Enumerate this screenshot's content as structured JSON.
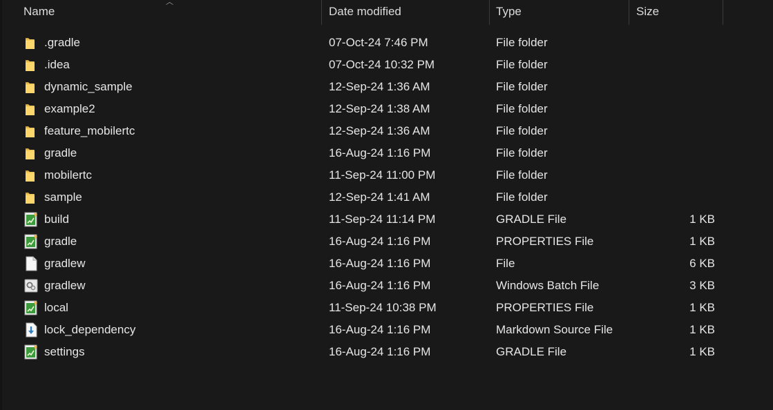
{
  "columns": {
    "name": "Name",
    "date_modified": "Date modified",
    "type": "Type",
    "size": "Size"
  },
  "files": [
    {
      "icon": "folder-icon",
      "name": ".gradle",
      "date": "07-Oct-24 7:46 PM",
      "type": "File folder",
      "size": ""
    },
    {
      "icon": "folder-icon",
      "name": ".idea",
      "date": "07-Oct-24 10:32 PM",
      "type": "File folder",
      "size": ""
    },
    {
      "icon": "folder-icon",
      "name": "dynamic_sample",
      "date": "12-Sep-24 1:36 AM",
      "type": "File folder",
      "size": ""
    },
    {
      "icon": "folder-icon",
      "name": "example2",
      "date": "12-Sep-24 1:38 AM",
      "type": "File folder",
      "size": ""
    },
    {
      "icon": "folder-icon",
      "name": "feature_mobilertc",
      "date": "12-Sep-24 1:36 AM",
      "type": "File folder",
      "size": ""
    },
    {
      "icon": "folder-icon",
      "name": "gradle",
      "date": "16-Aug-24 1:16 PM",
      "type": "File folder",
      "size": ""
    },
    {
      "icon": "folder-icon",
      "name": "mobilertc",
      "date": "11-Sep-24 11:00 PM",
      "type": "File folder",
      "size": ""
    },
    {
      "icon": "folder-icon",
      "name": "sample",
      "date": "12-Sep-24 1:41 AM",
      "type": "File folder",
      "size": ""
    },
    {
      "icon": "gradle-file-icon",
      "name": "build",
      "date": "11-Sep-24 11:14 PM",
      "type": "GRADLE File",
      "size": "1 KB"
    },
    {
      "icon": "gradle-file-icon",
      "name": "gradle",
      "date": "16-Aug-24 1:16 PM",
      "type": "PROPERTIES File",
      "size": "1 KB"
    },
    {
      "icon": "blank-file-icon",
      "name": "gradlew",
      "date": "16-Aug-24 1:16 PM",
      "type": "File",
      "size": "6 KB"
    },
    {
      "icon": "batch-file-icon",
      "name": "gradlew",
      "date": "16-Aug-24 1:16 PM",
      "type": "Windows Batch File",
      "size": "3 KB"
    },
    {
      "icon": "gradle-file-icon",
      "name": "local",
      "date": "11-Sep-24 10:38 PM",
      "type": "PROPERTIES File",
      "size": "1 KB"
    },
    {
      "icon": "markdown-file-icon",
      "name": "lock_dependency",
      "date": "16-Aug-24 1:16 PM",
      "type": "Markdown Source File",
      "size": "1 KB"
    },
    {
      "icon": "gradle-file-icon",
      "name": "settings",
      "date": "16-Aug-24 1:16 PM",
      "type": "GRADLE File",
      "size": "1 KB"
    }
  ]
}
